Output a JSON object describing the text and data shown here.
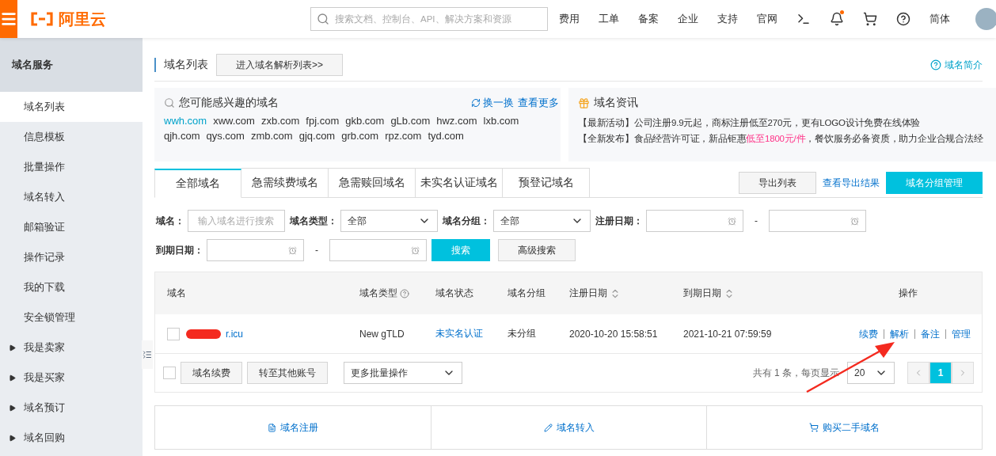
{
  "topbar": {
    "logo_text": "阿里云",
    "search_placeholder": "搜索文档、控制台、API、解决方案和资源",
    "nav": [
      "费用",
      "工单",
      "备案",
      "企业",
      "支持",
      "官网"
    ],
    "notification_dot": true,
    "language": "简体"
  },
  "sidebar": {
    "title": "域名服务",
    "items": [
      {
        "label": "域名列表",
        "selected": true,
        "kind": "link"
      },
      {
        "label": "信息模板",
        "selected": false,
        "kind": "link"
      },
      {
        "label": "批量操作",
        "selected": false,
        "kind": "link"
      },
      {
        "label": "域名转入",
        "selected": false,
        "kind": "link"
      },
      {
        "label": "邮箱验证",
        "selected": false,
        "kind": "link"
      },
      {
        "label": "操作记录",
        "selected": false,
        "kind": "link"
      },
      {
        "label": "我的下载",
        "selected": false,
        "kind": "link"
      },
      {
        "label": "安全锁管理",
        "selected": false,
        "kind": "link"
      },
      {
        "label": "我是卖家",
        "selected": false,
        "kind": "group"
      },
      {
        "label": "我是买家",
        "selected": false,
        "kind": "group"
      },
      {
        "label": "域名预订",
        "selected": false,
        "kind": "group"
      },
      {
        "label": "域名回购",
        "selected": false,
        "kind": "group"
      }
    ]
  },
  "page": {
    "title": "域名列表",
    "dns_button": "进入域名解析列表>>",
    "help_link": "域名简介"
  },
  "suggest": {
    "title": "您可能感兴趣的域名",
    "refresh": "换一换",
    "more": "查看更多",
    "domains": [
      {
        "name": "wwh.com",
        "highlighted": true
      },
      {
        "name": "xww.com",
        "highlighted": false
      },
      {
        "name": "zxb.com",
        "highlighted": false
      },
      {
        "name": "fpj.com",
        "highlighted": false
      },
      {
        "name": "gkb.com",
        "highlighted": false
      },
      {
        "name": "gLb.com",
        "highlighted": false
      },
      {
        "name": "hwz.com",
        "highlighted": false
      },
      {
        "name": "lxb.com",
        "highlighted": false
      },
      {
        "name": "qjh.com",
        "highlighted": false
      },
      {
        "name": "qys.com",
        "highlighted": false
      },
      {
        "name": "zmb.com",
        "highlighted": false
      },
      {
        "name": "gjq.com",
        "highlighted": false
      },
      {
        "name": "grb.com",
        "highlighted": false
      },
      {
        "name": "rpz.com",
        "highlighted": false
      },
      {
        "name": "tyd.com",
        "highlighted": false
      }
    ]
  },
  "news": {
    "title": "域名资讯",
    "items": [
      "【最新活动】公司注册9.9元起，商标注册低至270元，更有LOGO设计免费在线体验",
      "【全新发布】食品经营许可证，新品钜惠**低至1800元/件**，餐饮服务必备资质，助力企业合规合法经"
    ]
  },
  "tabs": [
    {
      "label": "全部域名",
      "selected": true
    },
    {
      "label": "急需续费域名",
      "selected": false
    },
    {
      "label": "急需赎回域名",
      "selected": false
    },
    {
      "label": "未实名认证域名",
      "selected": false
    },
    {
      "label": "预登记域名",
      "selected": false
    }
  ],
  "toolbar": {
    "export": "导出列表",
    "view_export": "查看导出结果",
    "group_manage": "域名分组管理"
  },
  "filters": {
    "domain_label": "域名：",
    "domain_placeholder": "输入域名进行搜索",
    "type_label": "域名类型：",
    "type_value": "全部",
    "group_label": "域名分组：",
    "group_value": "全部",
    "reg_label": "注册日期：",
    "reg_sep": "-",
    "exp_label": "到期日期：",
    "exp_sep": "-",
    "search": "搜索",
    "advanced": "高级搜索"
  },
  "table": {
    "columns": [
      {
        "label": "域名",
        "kind": "plain"
      },
      {
        "label": "域名类型",
        "kind": "help"
      },
      {
        "label": "域名状态",
        "kind": "plain"
      },
      {
        "label": "域名分组",
        "kind": "plain"
      },
      {
        "label": "注册日期",
        "kind": "sort"
      },
      {
        "label": "到期日期",
        "kind": "sort"
      },
      {
        "label": "操作",
        "kind": "plain"
      }
    ],
    "rows": [
      {
        "checked": false,
        "domain": "r.icu",
        "type": "New gTLD",
        "status": "未实名认证",
        "group": "未分组",
        "registered": "2020-10-20 15:58:51",
        "expires": "2021-10-21 07:59:59",
        "actions": [
          "续费",
          "解析",
          "备注",
          "管理"
        ]
      }
    ]
  },
  "bulk": {
    "checked": false,
    "buttons": [
      "域名续费",
      "转至其他账号"
    ],
    "more_select": "更多批量操作",
    "total": "共有 1 条，每页显示",
    "page_size": "20",
    "pages": [
      {
        "label": "1",
        "selected": true
      }
    ]
  },
  "quick_links": [
    {
      "label": "域名注册",
      "kind": "register"
    },
    {
      "label": "域名转入",
      "kind": "transfer"
    },
    {
      "label": "购买二手域名",
      "kind": "cart"
    }
  ]
}
